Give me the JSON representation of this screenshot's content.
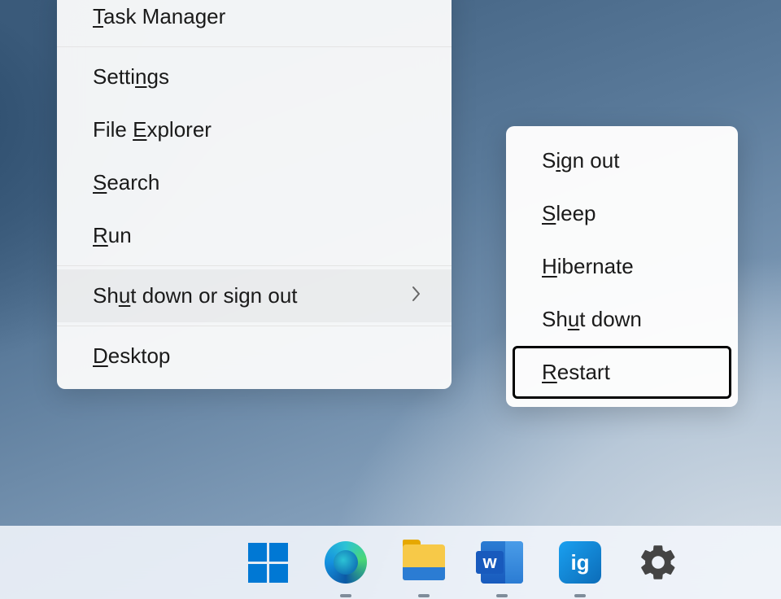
{
  "main_menu": {
    "items": [
      {
        "label": "Task Manager",
        "accelerator": "T"
      },
      {
        "label": "Settings",
        "accelerator": "n"
      },
      {
        "label": "File Explorer",
        "accelerator": "E"
      },
      {
        "label": "Search",
        "accelerator": "S"
      },
      {
        "label": "Run",
        "accelerator": "R"
      },
      {
        "label": "Shut down or sign out",
        "accelerator": "u",
        "submenu": true,
        "hovered": true
      },
      {
        "label": "Desktop",
        "accelerator": "D"
      }
    ]
  },
  "submenu": {
    "items": [
      {
        "label": "Sign out",
        "accelerator": "i"
      },
      {
        "label": "Sleep",
        "accelerator": "S"
      },
      {
        "label": "Hibernate",
        "accelerator": "H"
      },
      {
        "label": "Shut down",
        "accelerator": "u"
      },
      {
        "label": "Restart",
        "accelerator": "R",
        "highlighted": true
      }
    ]
  },
  "taskbar": {
    "icons": [
      {
        "name": "start",
        "indicator": false
      },
      {
        "name": "edge",
        "indicator": true
      },
      {
        "name": "file-explorer",
        "indicator": true
      },
      {
        "name": "word",
        "indicator": true
      },
      {
        "name": "ig",
        "label": "ig",
        "indicator": true
      },
      {
        "name": "settings",
        "indicator": false
      }
    ]
  },
  "word_badge_letter": "w"
}
